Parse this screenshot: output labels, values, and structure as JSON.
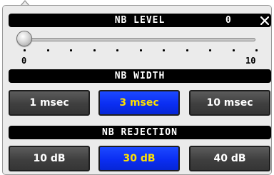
{
  "level": {
    "title": "NB LEVEL",
    "value": "0",
    "close_glyph": "×",
    "close_icon": "close-icon",
    "slider": {
      "min_label": "0",
      "max_label": "10",
      "current": 0
    }
  },
  "width": {
    "title": "NB WIDTH",
    "options": [
      {
        "label": "1 msec",
        "active": false
      },
      {
        "label": "3 msec",
        "active": true
      },
      {
        "label": "10 msec",
        "active": false
      }
    ]
  },
  "rejection": {
    "title": "NB REJECTION",
    "options": [
      {
        "label": "10 dB",
        "active": false
      },
      {
        "label": "30 dB",
        "active": true
      },
      {
        "label": "40 dB",
        "active": false
      }
    ]
  },
  "colors": {
    "bar_bg": "#000000",
    "button_bg": "#3f3f3f",
    "active_bg": "#0b2ef2",
    "active_text": "#ffe100",
    "panel_bg": "#ebebeb"
  }
}
